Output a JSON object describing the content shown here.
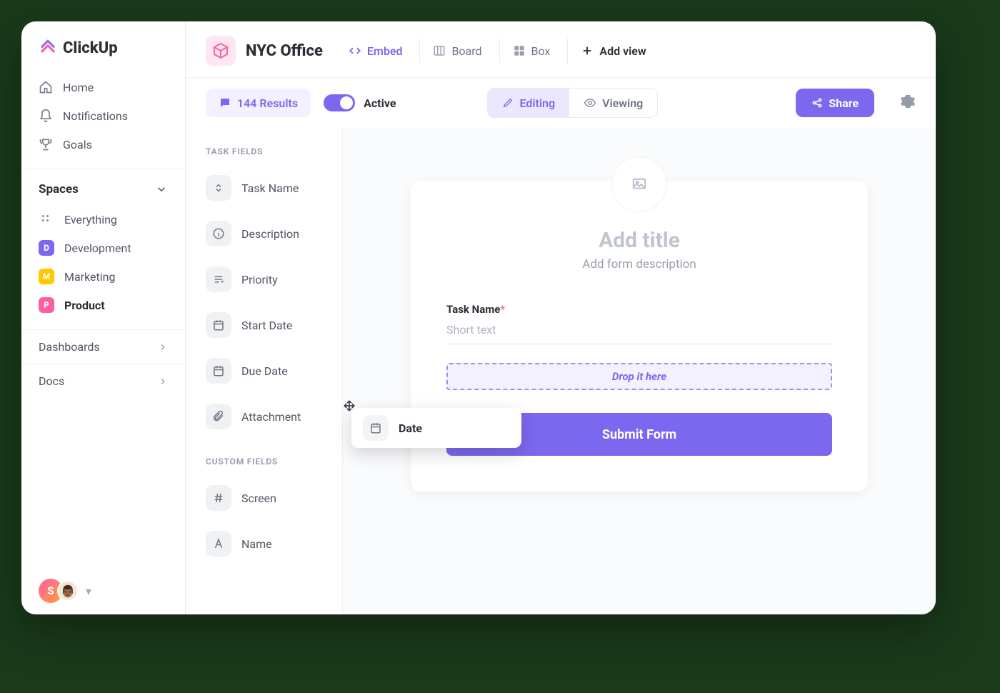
{
  "brand": "ClickUp",
  "nav": {
    "home": "Home",
    "notifications": "Notifications",
    "goals": "Goals"
  },
  "sidebar": {
    "spaces_label": "Spaces",
    "everything": "Everything",
    "items": [
      {
        "letter": "D",
        "label": "Development"
      },
      {
        "letter": "M",
        "label": "Marketing"
      },
      {
        "letter": "P",
        "label": "Product"
      }
    ],
    "dashboards": "Dashboards",
    "docs": "Docs",
    "avatar_initial": "S"
  },
  "topbar": {
    "space_title": "NYC Office",
    "views": {
      "embed": "Embed",
      "board": "Board",
      "box": "Box",
      "add": "Add view"
    }
  },
  "toolbar": {
    "results": "144 Results",
    "active": "Active",
    "editing": "Editing",
    "viewing": "Viewing",
    "share": "Share"
  },
  "fields_panel": {
    "task_fields_header": "TASK FIELDS",
    "custom_fields_header": "CUSTOM FIELDS",
    "task_fields": [
      {
        "label": "Task Name"
      },
      {
        "label": "Description"
      },
      {
        "label": "Priority"
      },
      {
        "label": "Start Date"
      },
      {
        "label": "Due Date"
      },
      {
        "label": "Attachment"
      }
    ],
    "custom_fields": [
      {
        "label": "Screen"
      },
      {
        "label": "Name"
      }
    ]
  },
  "form": {
    "title_placeholder": "Add title",
    "desc_placeholder": "Add form description",
    "field1_label": "Task Name",
    "field1_placeholder": "Short text",
    "dropzone": "Drop it here",
    "submit": "Submit Form"
  },
  "drag_chip": {
    "label": "Date"
  }
}
